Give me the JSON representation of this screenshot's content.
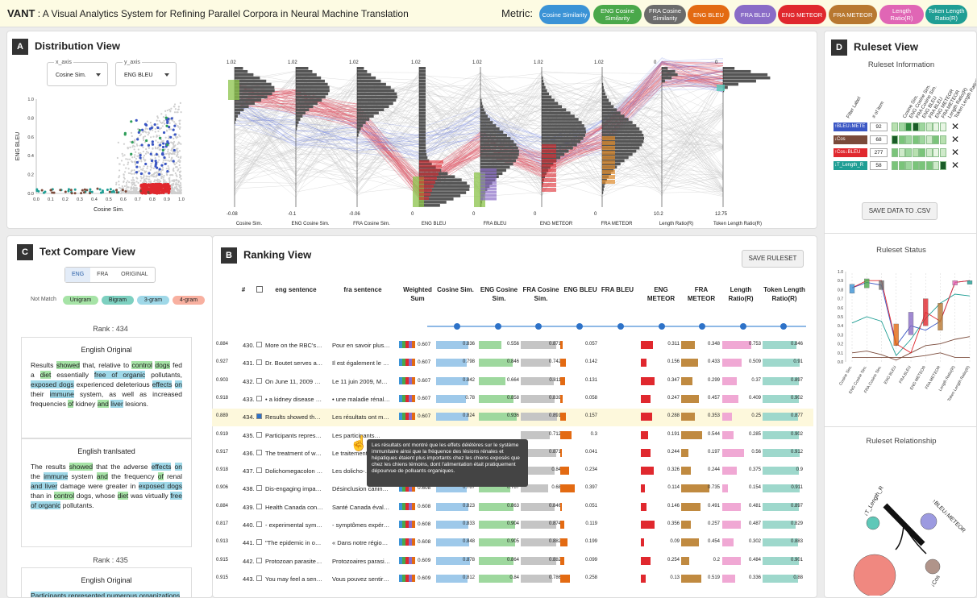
{
  "header": {
    "app_name": "VANT",
    "app_title": " : A Visual Analytics System for Refining Parallel Corpora in Neural Machine Translation",
    "metric_label": "Metric:",
    "metrics": [
      {
        "label": "Cosine Similarity",
        "color": "#3b93d6"
      },
      {
        "label": "ENG Cosine Similarity",
        "color": "#4aa84a"
      },
      {
        "label": "FRA Cosine Similarity",
        "color": "#6b6b6b"
      },
      {
        "label": "ENG BLEU",
        "color": "#e36a12"
      },
      {
        "label": "FRA BLEU",
        "color": "#8a6cc7"
      },
      {
        "label": "ENG METEOR",
        "color": "#e0282e"
      },
      {
        "label": "FRA METEOR",
        "color": "#b87830"
      },
      {
        "label": "Length Ratio(R)",
        "color": "#e066b5"
      },
      {
        "label": "Token Length Ratio(R)",
        "color": "#1f9e94"
      }
    ]
  },
  "distribution": {
    "badge": "A",
    "title": "Distribution View",
    "x_axis_label": "x_axis",
    "x_axis_value": "Cosine Sim.",
    "y_axis_label": "y_axis",
    "y_axis_value": "ENG BLEU",
    "scatter_xlabel": "Cosine Sim.",
    "scatter_ylabel": "ENG BLEU",
    "scatter_xticks": [
      "0.0",
      "0.1",
      "0.2",
      "0.3",
      "0.4",
      "0.5",
      "0.6",
      "0.7",
      "0.8",
      "0.9",
      "1.0"
    ],
    "scatter_yticks": [
      "0.0",
      "0.2",
      "0.4",
      "0.6",
      "0.8",
      "1.0"
    ],
    "axes": [
      {
        "name": "Cosine Sim.",
        "max": "1.02",
        "min": "-0.08"
      },
      {
        "name": "ENG Cosine Sim.",
        "max": "1.02",
        "min": "-0.1"
      },
      {
        "name": "FRA Cosine Sim.",
        "max": "1.02",
        "min": "-0.06"
      },
      {
        "name": "ENG BLEU",
        "max": "1.02",
        "min": "0"
      },
      {
        "name": "FRA BLEU",
        "max": "1.02",
        "min": "0"
      },
      {
        "name": "ENG METEOR",
        "max": "1.02",
        "min": "0"
      },
      {
        "name": "FRA METEOR",
        "max": "1.02",
        "min": "0"
      },
      {
        "name": "Length Ratio(R)",
        "max": "0",
        "min": "10.2"
      },
      {
        "name": "Token Length Ratio(R)",
        "max": "0",
        "min": "12.75"
      }
    ]
  },
  "text_compare": {
    "badge": "C",
    "title": "Text Compare View",
    "tabs": [
      "ENG",
      "FRA",
      "ORIGINAL"
    ],
    "legend_not_match": "Not Match",
    "legend": [
      "Unigram",
      "Bigram",
      "3-gram",
      "4-gram"
    ],
    "rank1": "Rank : 434",
    "orig_title": "English Original",
    "orig_text": [
      [
        "Results ",
        ""
      ],
      [
        "showed",
        "u"
      ],
      [
        " that, relative to ",
        ""
      ],
      [
        "control",
        "u"
      ],
      [
        " ",
        ""
      ],
      [
        "dogs",
        "u"
      ],
      [
        " fed a ",
        ""
      ],
      [
        "diet",
        "u"
      ],
      [
        " essentially ",
        ""
      ],
      [
        "free of organic",
        "b"
      ],
      [
        " pollutants, ",
        ""
      ],
      [
        "exposed dogs",
        "b"
      ],
      [
        " experienced deleterious ",
        ""
      ],
      [
        "effects",
        "b"
      ],
      [
        " ",
        ""
      ],
      [
        "on",
        "b"
      ],
      [
        " their ",
        ""
      ],
      [
        "immune",
        "b"
      ],
      [
        " system, as well as increased frequencies ",
        ""
      ],
      [
        "of",
        "u"
      ],
      [
        " kidney ",
        ""
      ],
      [
        "and",
        "u"
      ],
      [
        " ",
        ""
      ],
      [
        "liver",
        "b"
      ],
      [
        " lesions.",
        ""
      ]
    ],
    "trans_title": "English tranlsated",
    "trans_text": [
      [
        "The results ",
        ""
      ],
      [
        "showed",
        "u"
      ],
      [
        " that the adverse ",
        ""
      ],
      [
        "effects",
        "b"
      ],
      [
        " ",
        ""
      ],
      [
        "on",
        "b"
      ],
      [
        " the ",
        ""
      ],
      [
        "immune",
        "b"
      ],
      [
        " system ",
        ""
      ],
      [
        "and",
        "u"
      ],
      [
        " the frequency ",
        ""
      ],
      [
        "of",
        "u"
      ],
      [
        " renal ",
        ""
      ],
      [
        "and liver",
        "b"
      ],
      [
        " damage were greater in ",
        ""
      ],
      [
        "exposed dogs",
        "b"
      ],
      [
        " than in ",
        ""
      ],
      [
        "control",
        "u"
      ],
      [
        " dogs, whose ",
        ""
      ],
      [
        "diet",
        "u"
      ],
      [
        " was virtually ",
        ""
      ],
      [
        "free of organic",
        "b"
      ],
      [
        " pollutants.",
        ""
      ]
    ],
    "rank2": "Rank : 435",
    "orig_title2": "English Original",
    "orig_text2": "Participants represented numerous organizations"
  },
  "ranking": {
    "badge": "B",
    "title": "Ranking View",
    "save_label": "SAVE RULESET",
    "headers": [
      "#",
      "eng sentence",
      "fra sentence",
      "Weighted Sum",
      "Cosine Sim.",
      "ENG Cosine Sim.",
      "FRA Cosine Sim.",
      "ENG BLEU",
      "FRA BLEU",
      "ENG METEOR",
      "FRA METEOR",
      "Length Ratio(R)",
      "Token Length Ratio(R)"
    ],
    "rows": [
      {
        "rank": "430.",
        "eng": "More on the RBC's…",
        "fra": "Pour en savoir plus…",
        "ws": "0.607",
        "v": [
          "0.836",
          "0.556",
          "0.871",
          "0.057",
          "",
          "0.311",
          "0.348",
          "0.753",
          "0.846",
          "0.884"
        ],
        "checked": false
      },
      {
        "rank": "431.",
        "eng": "Dr. Boutet serves a…",
        "fra": "Il est également le …",
        "ws": "0.607",
        "v": [
          "0.798",
          "0.846",
          "0.742",
          "0.142",
          "",
          "0.156",
          "0.433",
          "0.509",
          "0.91",
          "0.927"
        ],
        "checked": false
      },
      {
        "rank": "432.",
        "eng": "On June 11, 2009 …",
        "fra": "Le 11 juin 2009, M…",
        "ws": "0.607",
        "v": [
          "0.842",
          "0.664",
          "0.811",
          "0.131",
          "",
          "0.347",
          "0.299",
          "0.37",
          "0.897",
          "0.903"
        ],
        "checked": false
      },
      {
        "rank": "433.",
        "eng": "• a kidney disease …",
        "fra": "• une maladie rénal…",
        "ws": "0.607",
        "v": [
          "0.78",
          "0.858",
          "0.839",
          "0.058",
          "",
          "0.247",
          "0.457",
          "0.409",
          "0.902",
          "0.918"
        ],
        "checked": false
      },
      {
        "rank": "434.",
        "eng": "Results showed th…",
        "fra": "Les résultats ont m…",
        "ws": "0.607",
        "v": [
          "0.824",
          "0.936",
          "0.891",
          "0.157",
          "",
          "0.288",
          "0.353",
          "0.25",
          "0.877",
          "0.889"
        ],
        "checked": true
      },
      {
        "rank": "435.",
        "eng": "Participants repres…",
        "fra": "Les participants…",
        "ws": "",
        "v": [
          "",
          "",
          "0.712",
          "0.3",
          "",
          "0.191",
          "0.544",
          "0.285",
          "0.902",
          "0.919"
        ],
        "checked": false
      },
      {
        "rank": "436.",
        "eng": "The treatment of w…",
        "fra": "Le traitement…",
        "ws": "",
        "v": [
          "",
          "",
          "0.871",
          "0.041",
          "",
          "0.244",
          "0.197",
          "0.56",
          "0.912",
          "0.917"
        ],
        "checked": false
      },
      {
        "rank": "437.",
        "eng": "Dolichomegacolon …",
        "fra": "Les dolicho-…",
        "ws": "",
        "v": [
          "",
          "",
          "0.84",
          "0.234",
          "",
          "0.326",
          "0.244",
          "0.375",
          "0.9",
          "0.918"
        ],
        "checked": false
      },
      {
        "rank": "438.",
        "eng": "Dis-engaging impa…",
        "fra": "Désinclusion canin…",
        "ws": "0.608",
        "v": [
          "0.787",
          "0.787",
          "0.68",
          "0.397",
          "",
          "0.114",
          "0.735",
          "0.154",
          "0.911",
          "0.906"
        ],
        "checked": false
      },
      {
        "rank": "439.",
        "eng": "Health Canada con…",
        "fra": "Santé Canada éval…",
        "ws": "0.608",
        "v": [
          "0.823",
          "0.863",
          "0.846",
          "0.051",
          "",
          "0.146",
          "0.491",
          "0.481",
          "0.897",
          "0.884"
        ],
        "checked": false
      },
      {
        "rank": "440.",
        "eng": "- experimental sym…",
        "fra": "- symptômes expér…",
        "ws": "0.608",
        "v": [
          "0.833",
          "0.904",
          "0.874",
          "0.119",
          "",
          "0.356",
          "0.257",
          "0.487",
          "0.829",
          "0.817"
        ],
        "checked": false
      },
      {
        "rank": "441.",
        "eng": "\"The epidemic in o…",
        "fra": "« Dans notre régio…",
        "ws": "0.608",
        "v": [
          "0.848",
          "0.905",
          "0.882",
          "0.199",
          "",
          "0.09",
          "0.454",
          "0.302",
          "0.883",
          "0.913"
        ],
        "checked": false
      },
      {
        "rank": "442.",
        "eng": "Protozoan parasite…",
        "fra": "Protozoaires parasi…",
        "ws": "0.609",
        "v": [
          "0.878",
          "0.864",
          "0.882",
          "0.099",
          "",
          "0.254",
          "0.2",
          "0.484",
          "0.901",
          "0.915"
        ],
        "checked": false
      },
      {
        "rank": "443.",
        "eng": "You may feel a sen…",
        "fra": "Vous pouvez sentir…",
        "ws": "0.609",
        "v": [
          "0.812",
          "0.84",
          "0.786",
          "0.258",
          "",
          "0.13",
          "0.519",
          "0.336",
          "0.88",
          "0.915"
        ],
        "checked": false
      }
    ],
    "tooltip": "Les résultats ont montré que les effets délétères sur le système immunitaire ainsi que la fréquence des lésions rénales et hépatiques étaient plus importants chez les chiens exposés que chez les chiens témoins, dont l'alimentation était pratiquement dépourvue de polluants organiques."
  },
  "ruleset": {
    "badge": "D",
    "title": "Ruleset View",
    "info_title": "Ruleset Information",
    "col_headers": [
      "Filter Label",
      "# of item",
      "Cosine Sim.",
      "ENG Cosine Sim.",
      "FRA Cosine Sim.",
      "ENG BLEU",
      "FRA BLEU",
      "ENG METEOR",
      "FRA METEOR",
      "Length Ratio(R)",
      "Token Length Ratio(R)"
    ],
    "rules": [
      {
        "label": "↑BLEU↓METE",
        "count": "92",
        "color": "#3a56c4"
      },
      {
        "label": "↓Cos",
        "count": "68",
        "color": "#7a4a3a"
      },
      {
        "label": "↑Cos↓BLEU",
        "count": "277",
        "color": "#e0282e"
      },
      {
        "label": "↓T_Length_R",
        "count": "58",
        "color": "#1f9e94"
      }
    ],
    "save_csv": "SAVE DATA TO .CSV",
    "status_title": "Ruleset Status",
    "status_yticks": [
      "0.0",
      "0.1",
      "0.2",
      "0.3",
      "0.4",
      "0.5",
      "0.6",
      "0.7",
      "0.8",
      "0.9",
      "1.0"
    ],
    "status_xlabels": [
      "Cosine Sim.",
      "ENG Cosine Sim.",
      "FRA Cosine Sim.",
      "ENG BLEU",
      "FRA BLEU",
      "ENG METEOR",
      "FRA METEOR",
      "Length Ratio(R)",
      "Token Length Ratio(R)"
    ],
    "relationship_title": "Ruleset Relationship",
    "rel_nodes": [
      "↓T_Length_R",
      "↑BLEU↓METEOR",
      "↑Cos↓BLEU",
      "↓Cos"
    ]
  }
}
